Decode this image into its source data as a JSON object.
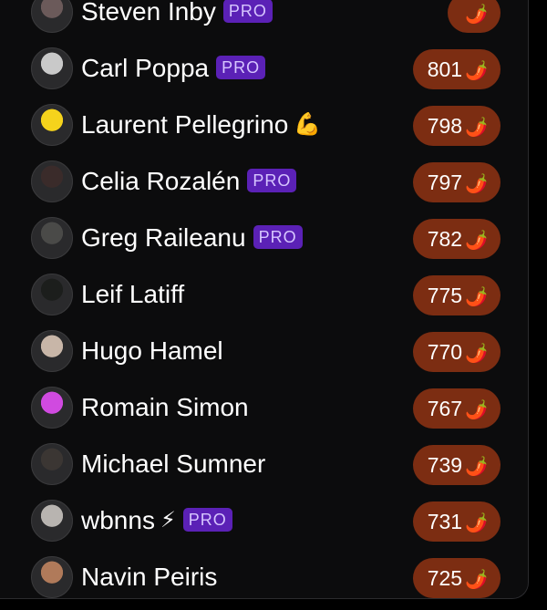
{
  "colors": {
    "background": "#000000",
    "panel": "#0c0c0d",
    "pro_badge": "#5b21b6",
    "score_pill": "#7c2d12"
  },
  "leaderboard": {
    "entries": [
      {
        "name": "Steven Inby",
        "pro": true,
        "badge": "PRO",
        "emoji": "",
        "score": "",
        "avatar_color": "#6b5a5a"
      },
      {
        "name": "Carl Poppa",
        "pro": true,
        "badge": "PRO",
        "emoji": "",
        "score": "801",
        "avatar_color": "#c9c9c9"
      },
      {
        "name": "Laurent Pellegrino",
        "pro": false,
        "badge": "",
        "emoji": "💪",
        "score": "798",
        "avatar_color": "#f5d31c"
      },
      {
        "name": "Celia Rozalén",
        "pro": true,
        "badge": "PRO",
        "emoji": "",
        "score": "797",
        "avatar_color": "#3a2b2a"
      },
      {
        "name": "Greg Raileanu",
        "pro": true,
        "badge": "PRO",
        "emoji": "",
        "score": "782",
        "avatar_color": "#4a4a48"
      },
      {
        "name": "Leif Latiff",
        "pro": false,
        "badge": "",
        "emoji": "",
        "score": "775",
        "avatar_color": "#1c1e1c"
      },
      {
        "name": "Hugo Hamel",
        "pro": false,
        "badge": "",
        "emoji": "",
        "score": "770",
        "avatar_color": "#c8b6a8"
      },
      {
        "name": "Romain Simon",
        "pro": false,
        "badge": "",
        "emoji": "",
        "score": "767",
        "avatar_color": "#d04ae0"
      },
      {
        "name": "Michael Sumner",
        "pro": false,
        "badge": "",
        "emoji": "",
        "score": "739",
        "avatar_color": "#3b3633"
      },
      {
        "name": "wbnns",
        "pro": true,
        "badge": "PRO",
        "emoji": "⚡",
        "score": "731",
        "avatar_color": "#b8b4b0"
      },
      {
        "name": "Navin Peiris",
        "pro": false,
        "badge": "",
        "emoji": "",
        "score": "725",
        "avatar_color": "#b07a5a"
      }
    ],
    "score_icon": "chili-pepper-icon",
    "score_glyph": "🌶️"
  }
}
